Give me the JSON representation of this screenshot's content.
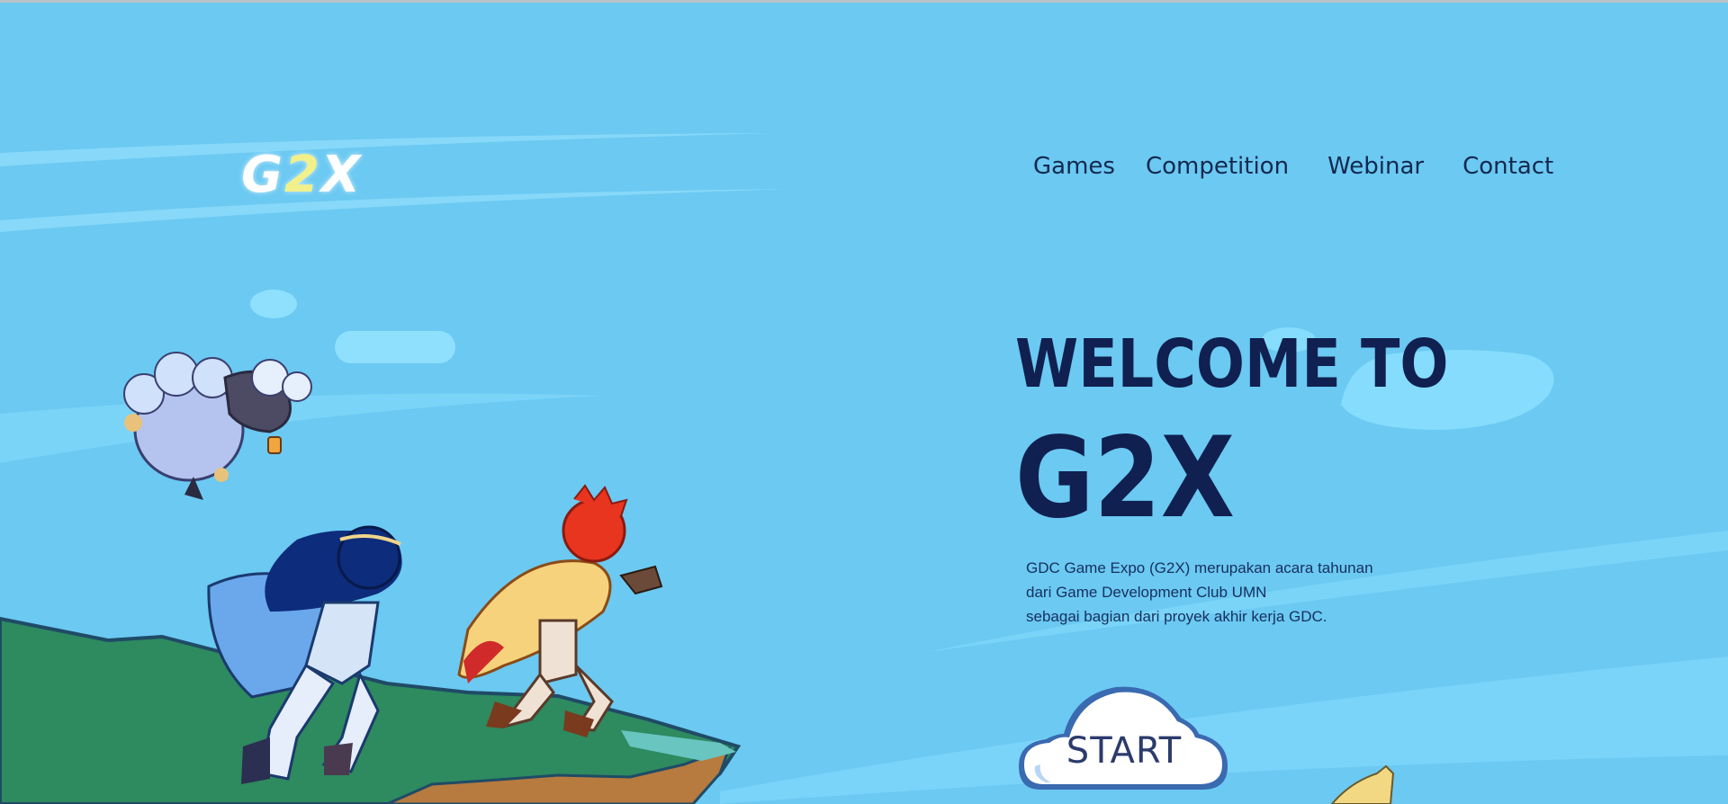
{
  "logo": {
    "part1": "G",
    "part2": "2",
    "part3": "X"
  },
  "nav": {
    "items": [
      {
        "label": "Games"
      },
      {
        "label": "Competition"
      },
      {
        "label": "Webinar"
      },
      {
        "label": "Contact"
      }
    ]
  },
  "hero": {
    "welcome": "WELCOME TO",
    "title": "G2X",
    "description": [
      "GDC Game Expo (G2X) merupakan acara tahunan",
      "dari Game Development Club UMN",
      "sebagai bagian dari proyek akhir kerja GDC."
    ],
    "start_label": "START"
  },
  "colors": {
    "sky": "#6bc9f2",
    "navy_text": "#102050",
    "grass": "#2e8a5f"
  }
}
